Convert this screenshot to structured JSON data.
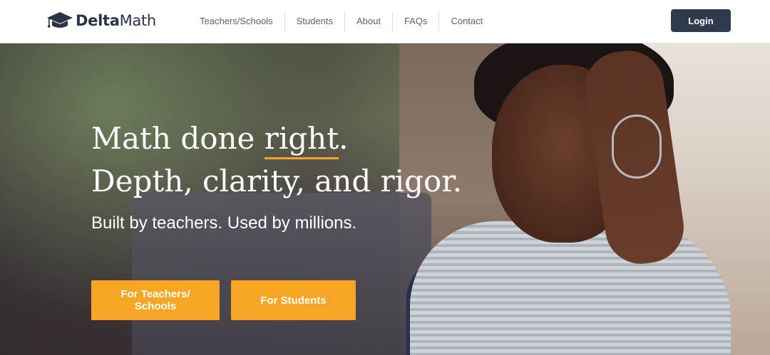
{
  "header": {
    "logo_text_bold": "Delta",
    "logo_text_rest": "Math",
    "nav": [
      "Teachers/Schools",
      "Students",
      "About",
      "FAQs",
      "Contact"
    ],
    "login_label": "Login"
  },
  "hero": {
    "title_line1_pre": "Math done ",
    "title_line1_em": "right",
    "title_line1_post": ".",
    "title_line2": "Depth, clarity, and rigor.",
    "subtitle": "Built by teachers. Used by millions.",
    "cta_teachers": "For Teachers/ Schools",
    "cta_students": "For Students"
  },
  "colors": {
    "accent": "#f6a623",
    "header_button": "#2f3a4c",
    "logo_text": "#2b3445"
  }
}
